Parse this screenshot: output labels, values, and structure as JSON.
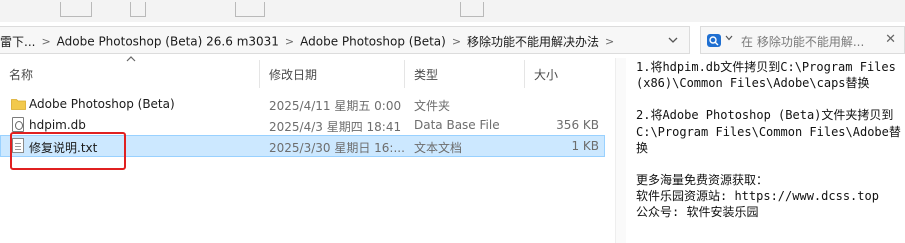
{
  "address": {
    "crumbs": [
      "雷下...",
      "Adobe Photoshop (Beta) 26.6 m3031",
      "Adobe Photoshop (Beta)",
      "移除功能不能用解决办法"
    ],
    "separator": ">",
    "dropdown_icon": "chevron-down-icon"
  },
  "search": {
    "placeholder": "在 移除功能不能用解...",
    "close_label": "✕"
  },
  "columns": {
    "name": "名称",
    "modified": "修改日期",
    "type": "类型",
    "size": "大小"
  },
  "files": [
    {
      "icon": "folder-icon",
      "name": "Adobe Photoshop (Beta)",
      "modified": "2025/4/11 星期五 0:00",
      "type": "文件夹",
      "size": ""
    },
    {
      "icon": "database-file-icon",
      "name": "hdpim.db",
      "modified": "2025/4/3 星期四 18:41",
      "type": "Data Base File",
      "size": "356 KB"
    },
    {
      "icon": "text-file-icon",
      "name": "修复说明.txt",
      "modified": "2025/3/30 星期日 16:...",
      "type": "文本文档",
      "size": "1 KB"
    }
  ],
  "selected_row": 2,
  "notes": {
    "p1": "1.将hdpim.db文件拷贝到C:\\Program Files (x86)\\Common Files\\Adobe\\caps替换",
    "p2": "2.将Adobe Photoshop (Beta)文件夹拷贝到C:\\Program Files\\Common Files\\Adobe替换",
    "p3_line1": "更多海量免费资源获取：",
    "p3_line2": "软件乐园资源站: https://www.dcss.top",
    "p3_line3": "公众号: 软件安装乐园"
  },
  "colors": {
    "selection": "#cce8ff",
    "highlight_box": "#e02020",
    "folder": "#f2c94c",
    "search_accent": "#1f6fd1"
  }
}
